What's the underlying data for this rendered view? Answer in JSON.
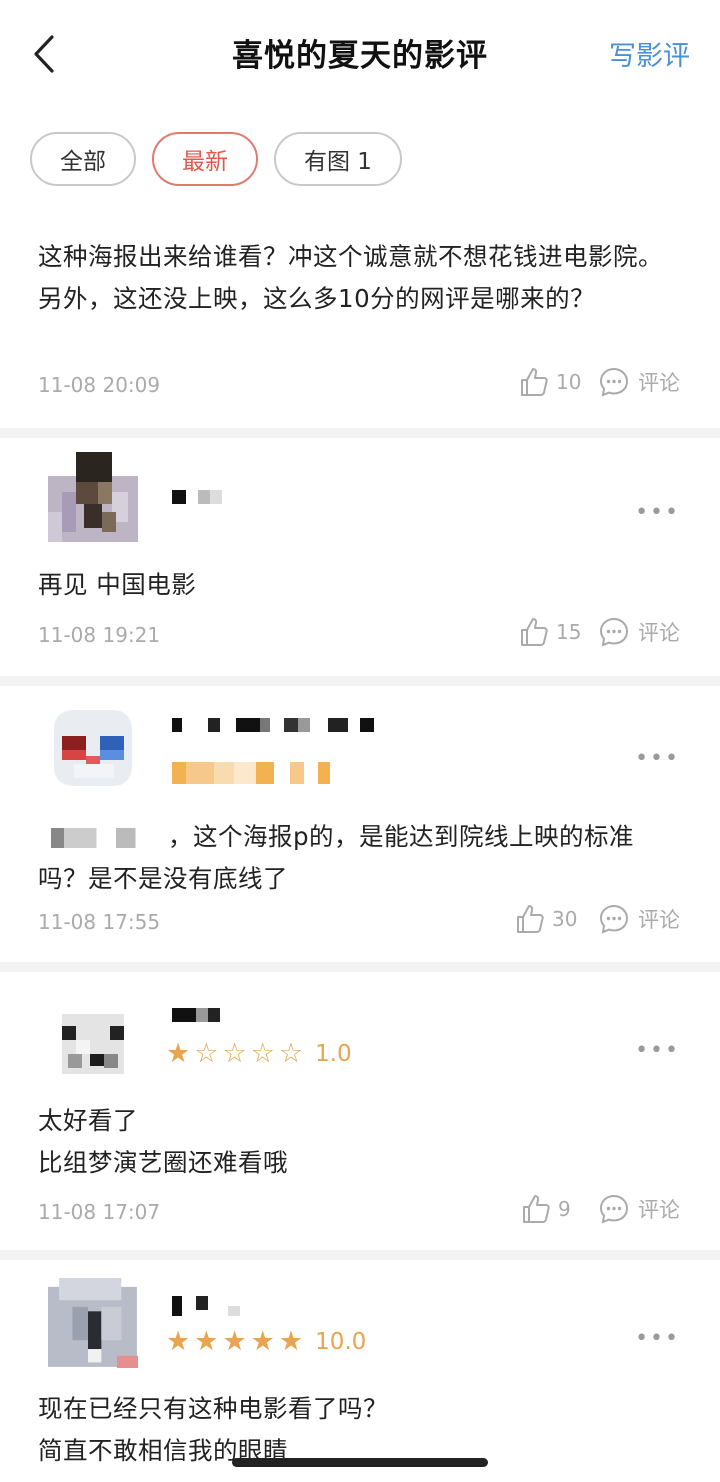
{
  "header": {
    "title": "喜悦的夏天的影评",
    "write_label": "写影评"
  },
  "filters": [
    {
      "label": "全部",
      "active": false
    },
    {
      "label": "最新",
      "active": true
    },
    {
      "label": "有图 1",
      "active": false
    }
  ],
  "reviews": [
    {
      "content": "这种海报出来给谁看？冲这个诚意就不想花钱进电影院。另外，这还没上映，这么多10分的网评是哪来的？",
      "time": "11-08 20:09",
      "likes": "10",
      "comment_label": "评论"
    },
    {
      "content": "再见  中国电影",
      "time": "11-08 19:21",
      "likes": "15",
      "comment_label": "评论"
    },
    {
      "content": "，这个海报p的，是能达到院线上映的标准吗？是不是没有底线了",
      "time": "11-08 17:55",
      "likes": "30",
      "comment_label": "评论"
    },
    {
      "rating": "1.0",
      "stars_filled": 1,
      "content_line1": "太好看了",
      "content_line2": "比组梦演艺圈还难看哦",
      "time": "11-08 17:07",
      "likes": "9",
      "comment_label": "评论"
    },
    {
      "rating": "10.0",
      "stars_filled": 5,
      "content_line1": "现在已经只有这种电影看了吗？",
      "content_line2": "简直不敢相信我的眼睛"
    }
  ],
  "more_label": "•••",
  "colors": {
    "accent_blue": "#4a90d9",
    "active_red": "#e05a4c",
    "star_orange": "#e8a44f",
    "meta_gray": "#aaaaaa"
  },
  "icons": [
    "back-arrow-icon",
    "thumbs-up-icon",
    "comment-bubble-icon",
    "more-dots-icon",
    "star-icon"
  ]
}
